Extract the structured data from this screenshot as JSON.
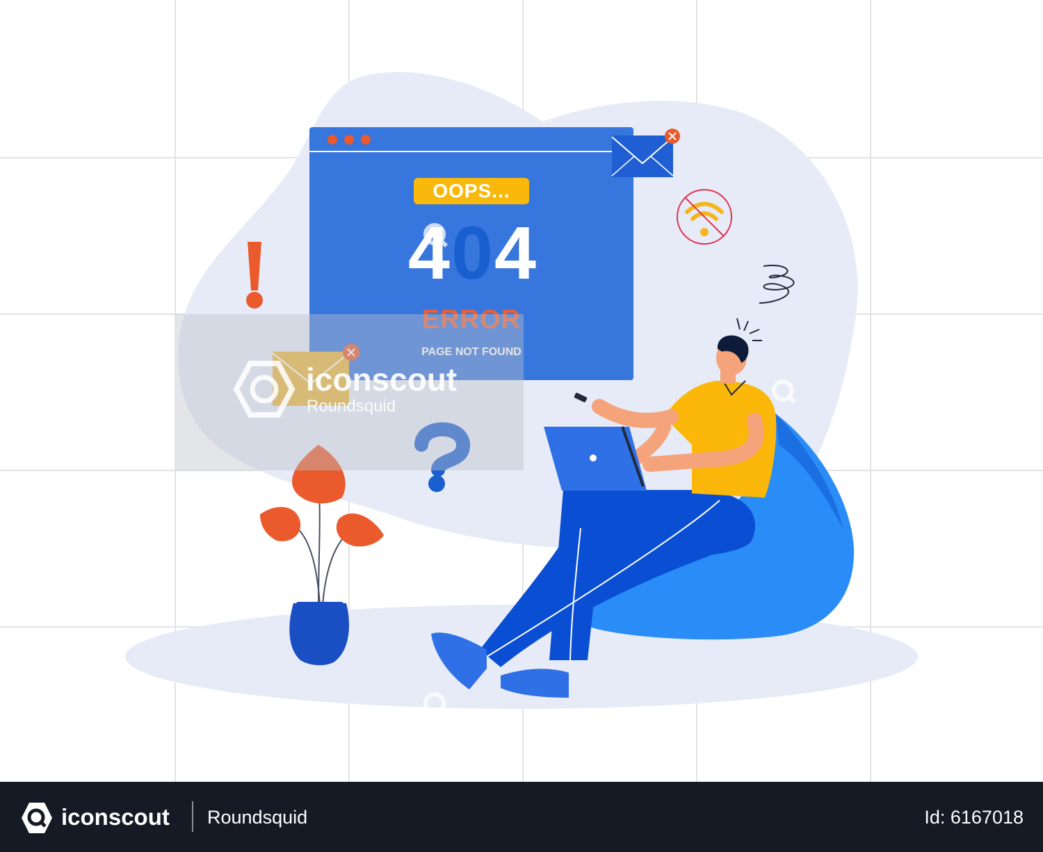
{
  "illustration": {
    "badge_text": "OOPS...",
    "code_left": "4",
    "code_middle": "0",
    "code_right": "4",
    "error_text": "ERROR",
    "subtitle": "PAGE NOT FOUND"
  },
  "watermark": {
    "brand": "iconscout",
    "author": "Roundsquid"
  },
  "footer": {
    "brand": "iconscout",
    "author": "Roundsquid",
    "asset_id": "Id: 6167018"
  },
  "colors": {
    "browser_blue": "#3776dc",
    "badge_yellow": "#f9b90c",
    "accent_orange": "#ea5a2c",
    "shirt_yellow": "#fbb80b",
    "pants_blue": "#0a4fd3",
    "beanbag_blue": "#2a8cf6",
    "footer_bg": "#161a25"
  }
}
